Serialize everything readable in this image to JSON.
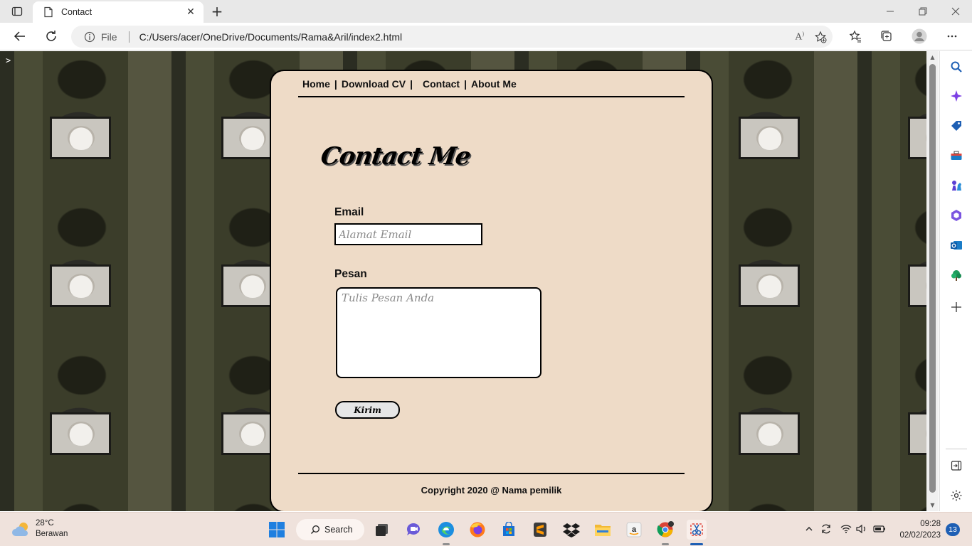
{
  "browser": {
    "tab_title": "Contact",
    "address_scheme": "File",
    "address_url": "C:/Users/acer/OneDrive/Documents/Rama&Aril/index2.html"
  },
  "page": {
    "corner_glyph": ">",
    "nav": {
      "home": "Home",
      "download_cv": "Download CV",
      "contact": "Contact",
      "about": "About Me",
      "separator": "|"
    },
    "heading": "Contact Me",
    "email_label": "Email",
    "email_placeholder": "Alamat Email",
    "message_label": "Pesan",
    "message_placeholder": "Tulis Pesan Anda",
    "submit_label": "Kirim",
    "copyright": "Copyright 2020 @ Nama pemilik"
  },
  "taskbar": {
    "weather_temp": "28°C",
    "weather_desc": "Berawan",
    "search_label": "Search",
    "time": "09:28",
    "date": "02/02/2023",
    "notification_count": "13"
  },
  "colors": {
    "panel_bg": "#eedbc7",
    "taskbar_bg": "#efe2dc",
    "edge_accent": "#1e5fb4"
  }
}
